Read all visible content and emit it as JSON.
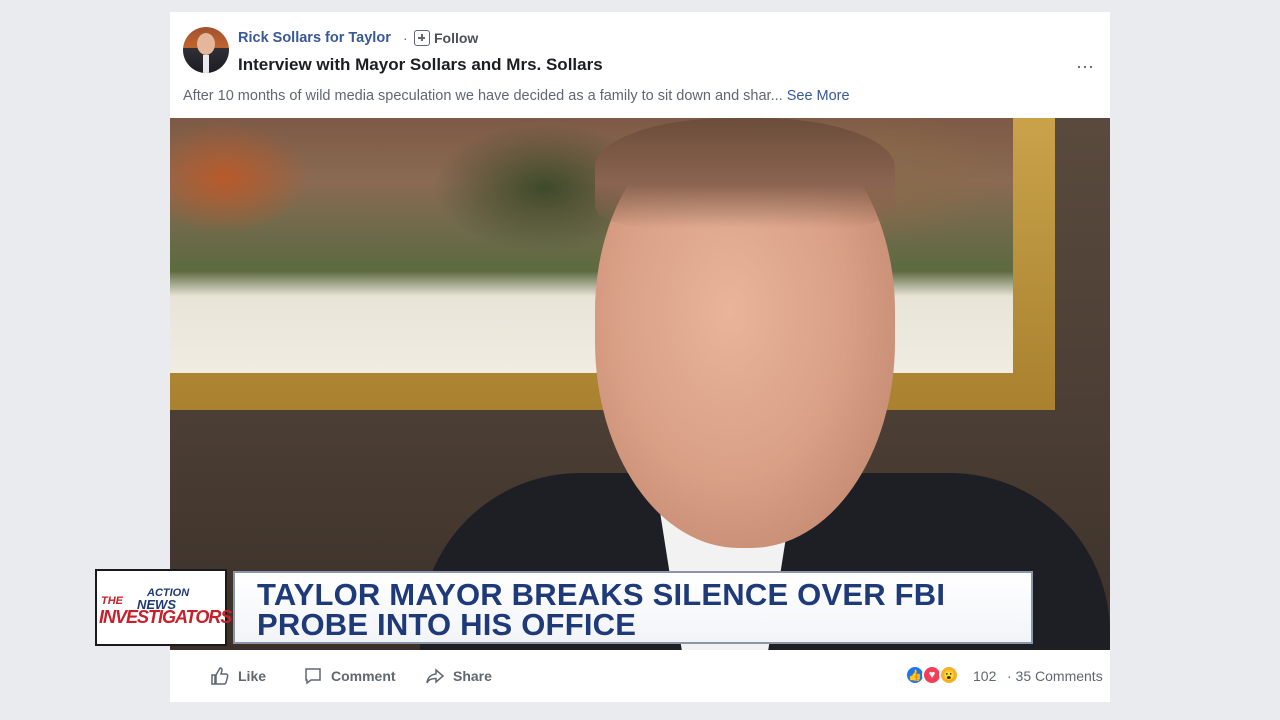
{
  "post": {
    "page_name": "Rick Sollars for Taylor",
    "separator": "·",
    "follow_label": "Follow",
    "title": "Interview with Mayor Sollars and Mrs. Sollars",
    "more_icon": "⋯",
    "text": "After 10 months of wild media speculation we have decided as a family to sit down and shar...",
    "see_more": "See More"
  },
  "lower_third": {
    "logo_action": "ACTION",
    "logo_news": "NEWS",
    "logo_the": "THE",
    "logo_investigators": "INVESTIGATORS",
    "headline_line1": "TAYLOR MAYOR BREAKS SILENCE OVER FBI",
    "headline_line2": "PROBE INTO HIS OFFICE"
  },
  "actions": {
    "like_label": "Like",
    "comment_label": "Comment",
    "share_label": "Share",
    "reaction_count": "102",
    "comments_count": "· 35 Comments"
  },
  "colors": {
    "link": "#385898",
    "headline": "#1f3a78",
    "logo_red": "#c8202a"
  }
}
